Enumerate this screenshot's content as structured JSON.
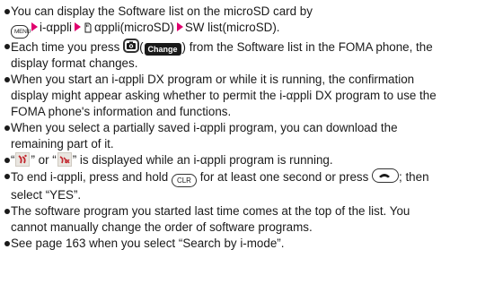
{
  "bullets": {
    "b1": {
      "line1": "You can display the Software list on the microSD card by",
      "key_menu": "MENU",
      "step1": "i-αppli",
      "step2": "αppli(microSD)",
      "step3": "SW list(microSD)."
    },
    "b2": {
      "pre": "Each time you press",
      "key_change": "Change",
      "post": "from the Software list in the FOMA phone, the",
      "line2": "display format changes."
    },
    "b3": {
      "line1": "When you start an i-αppli DX program or while it is running, the confirmation",
      "line2": "display might appear asking whether to permit the i-αppli DX program to use the",
      "line3": "FOMA phone's information and functions."
    },
    "b4": {
      "line1": "When you select a partially saved i-αppli program, you can download the",
      "line2": "remaining part of it."
    },
    "b5": {
      "q1": "“",
      "or": "” or “",
      "post": "” is displayed while an i-αppli program is running."
    },
    "b6": {
      "pre": "To end i-αppli, press and hold",
      "key_clr": "CLR",
      "mid": "for at least one second or press",
      "post": "; then",
      "line2": "select “YES”."
    },
    "b7": {
      "line1": "The software program you started last time comes at the top of the list. You",
      "line2": "cannot manually change the order of software programs."
    },
    "b8": {
      "line1": "See page 163 when you select “Search by i-mode”."
    }
  },
  "icons": {
    "arrow": "pink-triangle-arrow-icon",
    "sd": "microsd-card-icon",
    "camera": "camera-key-icon",
    "phone": "end-call-key-icon",
    "appli_running": "i-appli-running-icon",
    "appli_dx_running": "i-appli-dx-running-icon"
  },
  "colors": {
    "text": "#1a1a1a",
    "arrow": "#e0006e",
    "icon_bg": "#e9e6e0",
    "icon_red": "#c2262e"
  }
}
